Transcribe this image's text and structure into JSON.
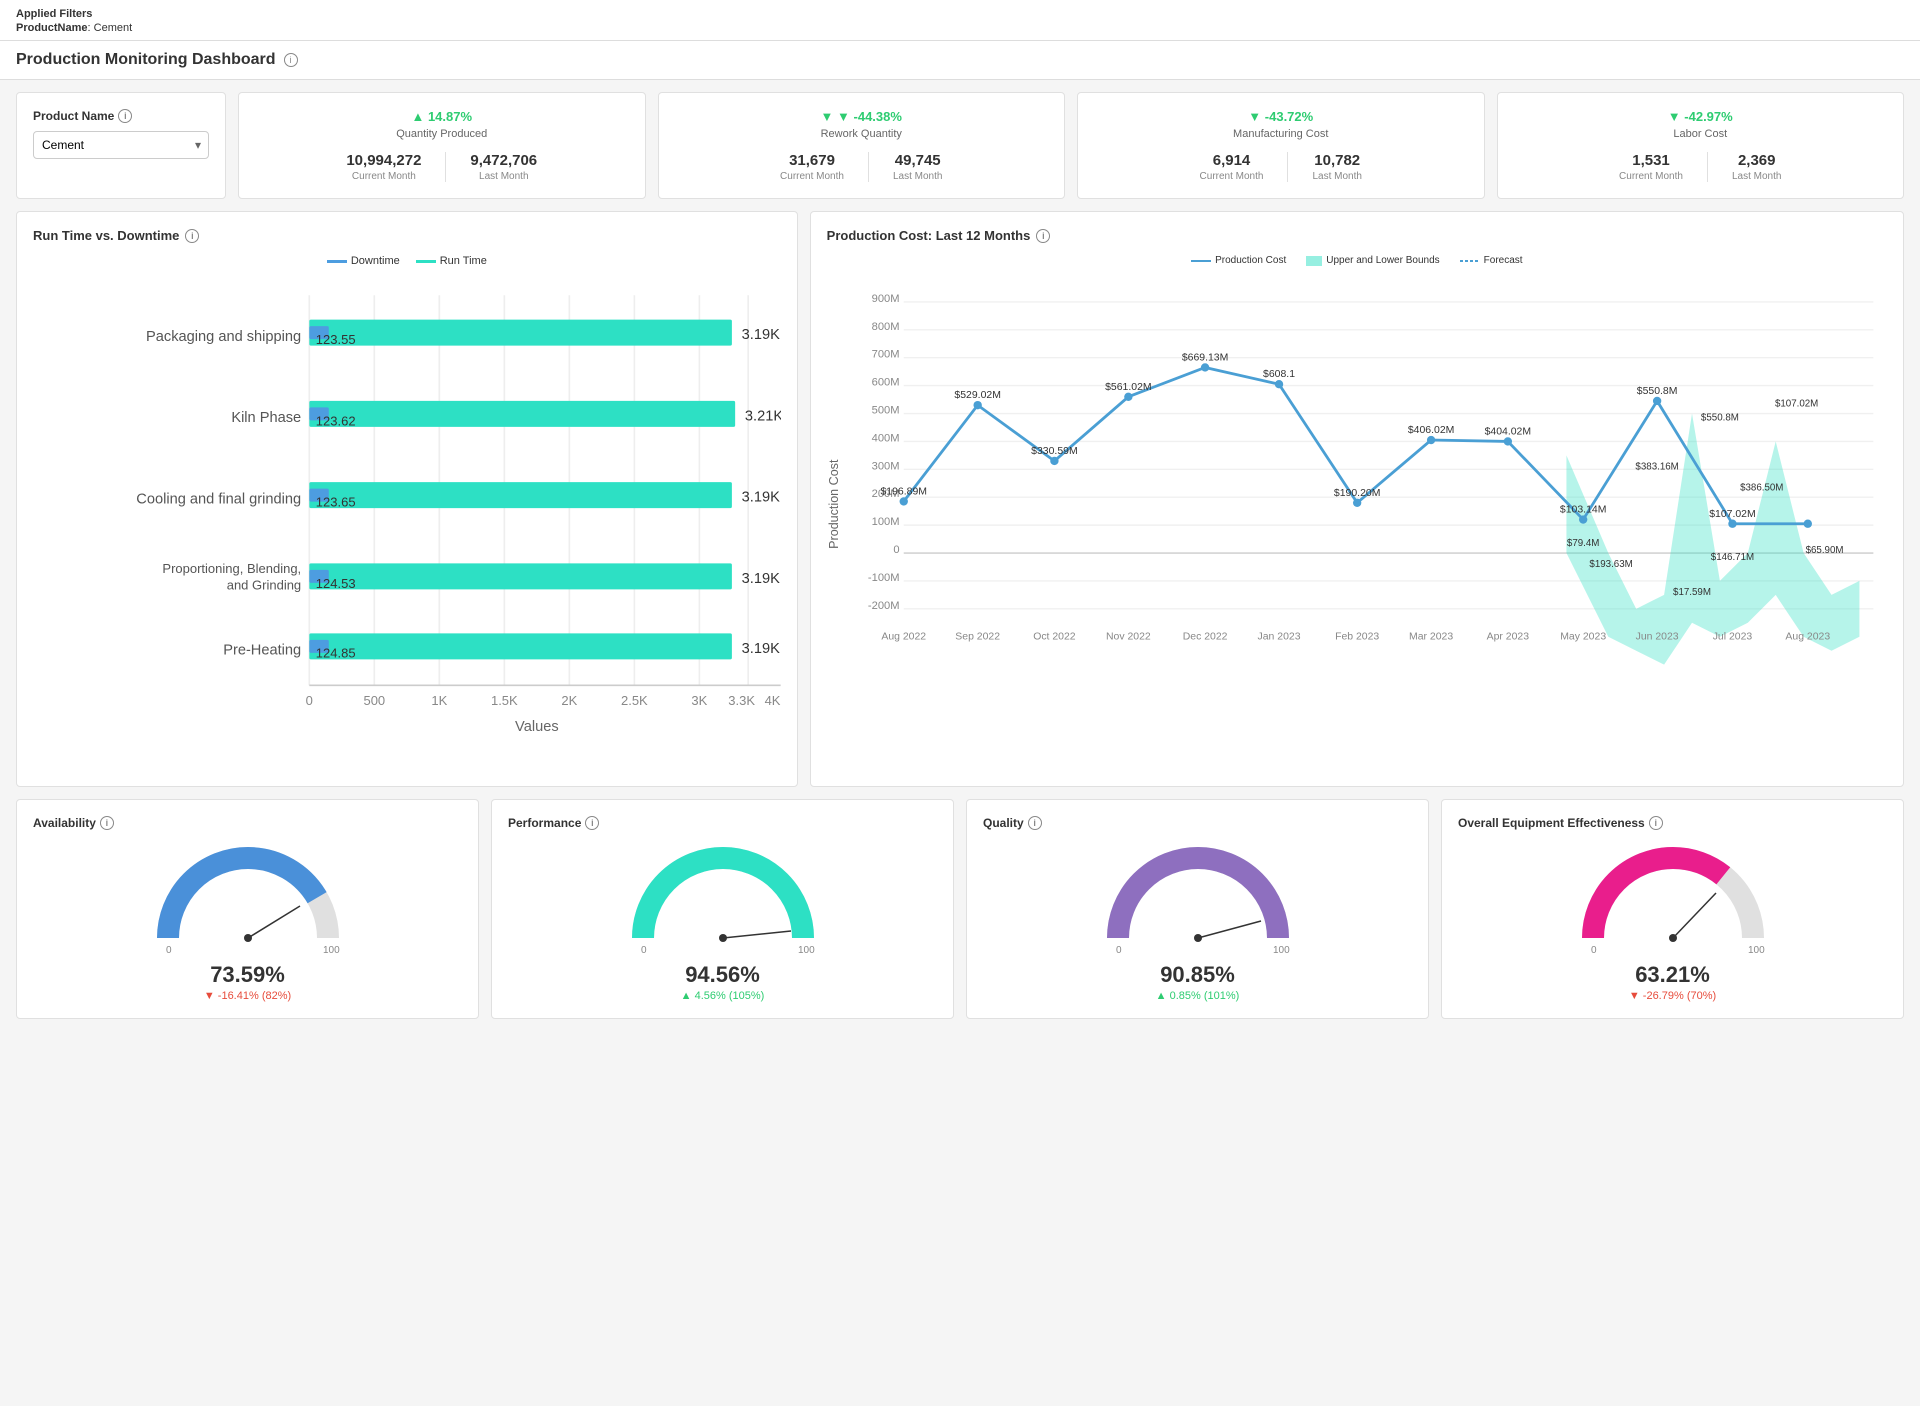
{
  "topBar": {
    "appliedFilters": "Applied Filters",
    "filterKey": "ProductName",
    "filterValue": "Cement"
  },
  "pageHeader": {
    "title": "Production Monitoring Dashboard"
  },
  "filterCard": {
    "label": "Product Name",
    "options": [
      "Cement"
    ],
    "selected": "Cement"
  },
  "kpiCards": [
    {
      "changeText": "14.87%",
      "changeDir": "up",
      "title": "Quantity Produced",
      "currentVal": "10,994,272",
      "lastVal": "9,472,706",
      "currentLabel": "Current Month",
      "lastLabel": "Last Month",
      "positive": true
    },
    {
      "changeText": "-44.38%",
      "changeDir": "down",
      "title": "Rework Quantity",
      "currentVal": "31,679",
      "lastVal": "49,745",
      "currentLabel": "Current Month",
      "lastLabel": "Last Month",
      "positive": true
    },
    {
      "changeText": "-43.72%",
      "changeDir": "down",
      "title": "Manufacturing Cost",
      "currentVal": "6,914",
      "lastVal": "10,782",
      "currentLabel": "Current Month",
      "lastLabel": "Last Month",
      "positive": true
    },
    {
      "changeText": "-42.97%",
      "changeDir": "down",
      "title": "Labor Cost",
      "currentVal": "1,531",
      "lastVal": "2,369",
      "currentLabel": "Current Month",
      "lastLabel": "Last Month",
      "positive": true
    }
  ],
  "barChart": {
    "title": "Run Time vs. Downtime",
    "legendDowntime": "Downtime",
    "legendRuntime": "Run Time",
    "xAxisLabel": "Values",
    "xTicks": [
      "0",
      "500",
      "1K",
      "1.5K",
      "2K",
      "2.5K",
      "3K",
      "3.3K",
      "4K"
    ],
    "bars": [
      {
        "label": "Packaging and shipping",
        "runVal": "3.19K",
        "downVal": "123.55",
        "runPct": 95,
        "downPct": 3.7
      },
      {
        "label": "Kiln Phase",
        "runVal": "3.21K",
        "downVal": "123.62",
        "runPct": 96,
        "downPct": 3.7
      },
      {
        "label": "Cooling and final grinding",
        "runVal": "3.19K",
        "downVal": "123.65",
        "runPct": 95,
        "downPct": 3.7
      },
      {
        "label": "Proportioning, Blending, and Grinding",
        "runVal": "3.19K",
        "downVal": "124.53",
        "runPct": 95,
        "downPct": 3.7
      },
      {
        "label": "Pre-Heating",
        "runVal": "3.19K",
        "downVal": "124.85",
        "runPct": 95,
        "downPct": 3.7
      }
    ]
  },
  "lineChart": {
    "title": "Production Cost: Last 12 Months",
    "legendProductionCost": "Production Cost",
    "legendUpperLower": "Upper and Lower Bounds",
    "legendForecast": "Forecast",
    "yAxisLabel": "Production Cost",
    "yTicks": [
      "900M",
      "800M",
      "700M",
      "600M",
      "500M",
      "400M",
      "300M",
      "200M",
      "100M",
      "0",
      "-100M",
      "-200M"
    ],
    "xTicks": [
      "Aug 2022",
      "Sep 2022",
      "Oct 2022",
      "Nov 2022",
      "Dec 2022",
      "Jan 2023",
      "Feb 2023",
      "Mar 2023",
      "Apr 2023",
      "May 2023",
      "Jun 2023",
      "Jul 2023",
      "Aug 2023"
    ],
    "dataPoints": [
      {
        "x": 0,
        "y": "$196.89M"
      },
      {
        "x": 1,
        "y": "$529.02M"
      },
      {
        "x": 2,
        "y": "$330.59M"
      },
      {
        "x": 3,
        "y": "$561.02M"
      },
      {
        "x": 4,
        "y": "$669.13M"
      },
      {
        "x": 5,
        "y": "$608.1"
      },
      {
        "x": 6,
        "y": "$190.20M"
      },
      {
        "x": 7,
        "y": "$406.02M"
      },
      {
        "x": 8,
        "y": "$404.02M"
      },
      {
        "x": 9,
        "y": "$103.14M"
      },
      {
        "x": 10,
        "y": "$550.8M"
      },
      {
        "x": 11,
        "y": "$107.02M"
      }
    ]
  },
  "gauges": [
    {
      "title": "Availability",
      "value": "73.59%",
      "changeText": "▼ -16.41% (82%)",
      "changePositive": false,
      "color": "#4a90d9",
      "pct": 73.59,
      "minLabel": "0",
      "maxLabel": "100"
    },
    {
      "title": "Performance",
      "value": "94.56%",
      "changeText": "▲ 4.56% (105%)",
      "changePositive": true,
      "color": "#2de0c4",
      "pct": 94.56,
      "minLabel": "0",
      "maxLabel": "100"
    },
    {
      "title": "Quality",
      "value": "90.85%",
      "changeText": "▲ 0.85% (101%)",
      "changePositive": true,
      "color": "#8e6fbf",
      "pct": 90.85,
      "minLabel": "0",
      "maxLabel": "100"
    },
    {
      "title": "Overall Equipment Effectiveness",
      "value": "63.21%",
      "changeText": "▼ -26.79% (70%)",
      "changePositive": false,
      "color": "#e91e8c",
      "pct": 63.21,
      "minLabel": "0",
      "maxLabel": "100"
    }
  ]
}
